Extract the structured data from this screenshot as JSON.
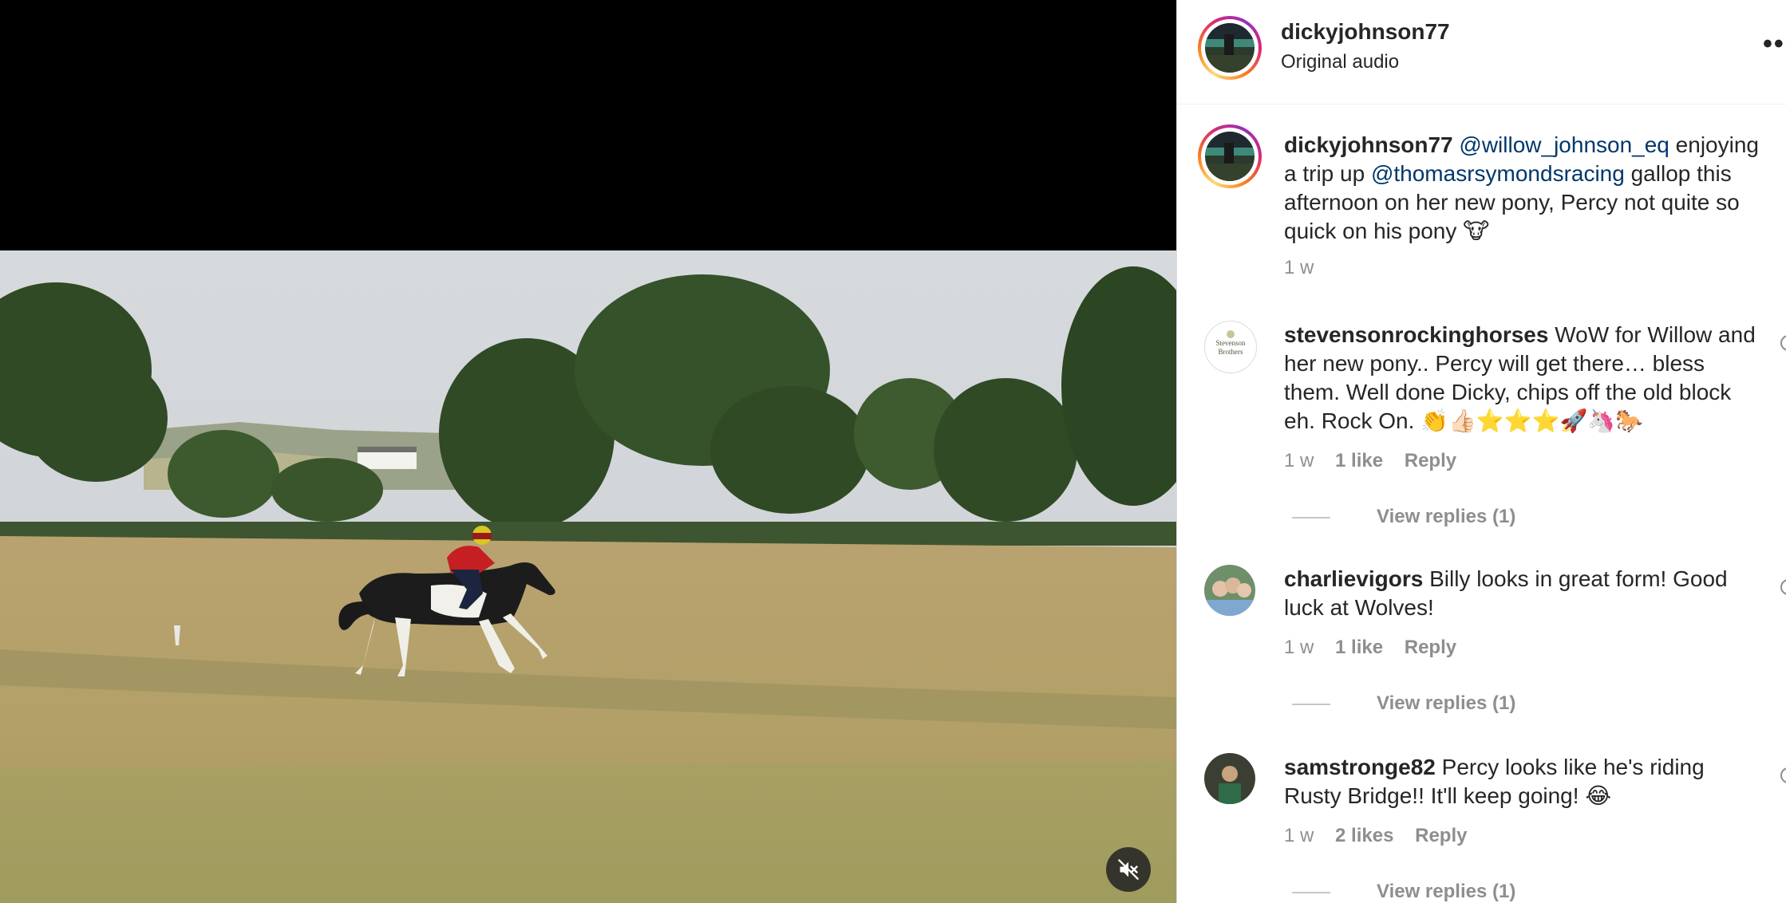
{
  "post": {
    "username": "dickyjohnson77",
    "audio": "Original audio",
    "more_label": "•••"
  },
  "caption": {
    "username": "dickyjohnson77",
    "mention1": "@willow_johnson_eq",
    "text1": " enjoying a trip up ",
    "mention2": "@thomasrsymondsracing",
    "text2": " gallop this afternoon on her new pony, Percy not quite so quick on his pony 🐮",
    "time": "1 w"
  },
  "comments": [
    {
      "username": "stevensonrockinghorses",
      "avatar_text": "Stevenson Brothers",
      "text": "WoW for Willow and her new pony.. Percy will get there… bless them. Well done Dicky, chips off the old block eh. Rock On. 👏👍🏻⭐⭐⭐🚀🦄🐎",
      "time": "1 w",
      "likes": "1 like",
      "reply": "Reply",
      "view_replies": "View replies (1)"
    },
    {
      "username": "charlievigors",
      "text": "Billy looks in great form! Good luck at Wolves!",
      "time": "1 w",
      "likes": "1 like",
      "reply": "Reply",
      "view_replies": "View replies (1)"
    },
    {
      "username": "samstronge82",
      "text": "Percy looks like he's riding Rusty Bridge!! It'll keep going! 😂",
      "time": "1 w",
      "likes": "2 likes",
      "reply": "Reply",
      "view_replies": "View replies (1)"
    }
  ],
  "media": {
    "mute_icon": "speaker-muted-icon"
  },
  "colors": {
    "mention": "#00376b",
    "secondary_text": "#8e8e8e",
    "story_ring": [
      "#feda75",
      "#fa7e1e",
      "#d62976",
      "#962fbf"
    ]
  }
}
